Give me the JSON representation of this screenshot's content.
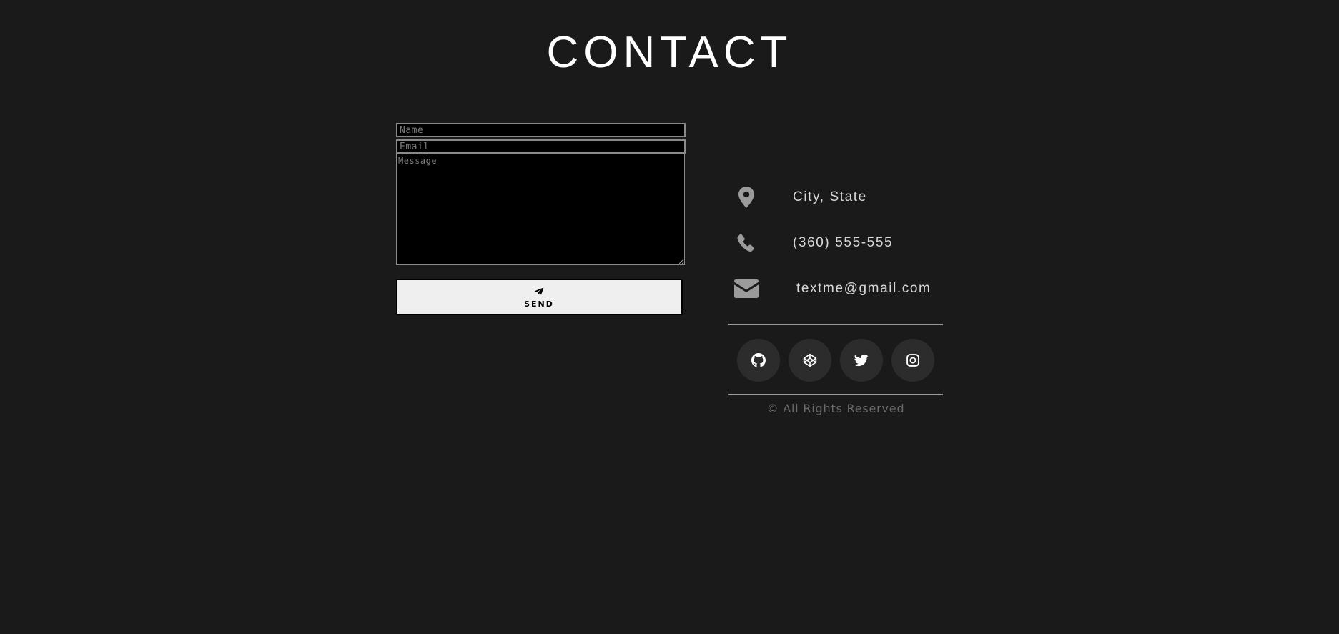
{
  "header": {
    "title": "CONTACT"
  },
  "form": {
    "name_placeholder": "Name",
    "email_placeholder": "Email",
    "message_placeholder": "Message",
    "send_label": "SEND",
    "send_icon": "paper-plane-icon"
  },
  "contact": {
    "location": {
      "icon": "map-marker-icon",
      "text": "City, State"
    },
    "phone": {
      "icon": "phone-icon",
      "text": "(360) 555-555"
    },
    "email": {
      "icon": "envelope-icon",
      "text": "textme@gmail.com"
    }
  },
  "social": [
    {
      "name": "github",
      "icon": "github-icon"
    },
    {
      "name": "codepen",
      "icon": "codepen-icon"
    },
    {
      "name": "twitter",
      "icon": "twitter-icon"
    },
    {
      "name": "instagram",
      "icon": "instagram-icon"
    }
  ],
  "footer": {
    "copyright": "© All Rights Reserved"
  },
  "colors": {
    "background": "#1b1a1b",
    "icon_gray": "#9b9b9b",
    "social_bg": "#2d2c2d"
  }
}
